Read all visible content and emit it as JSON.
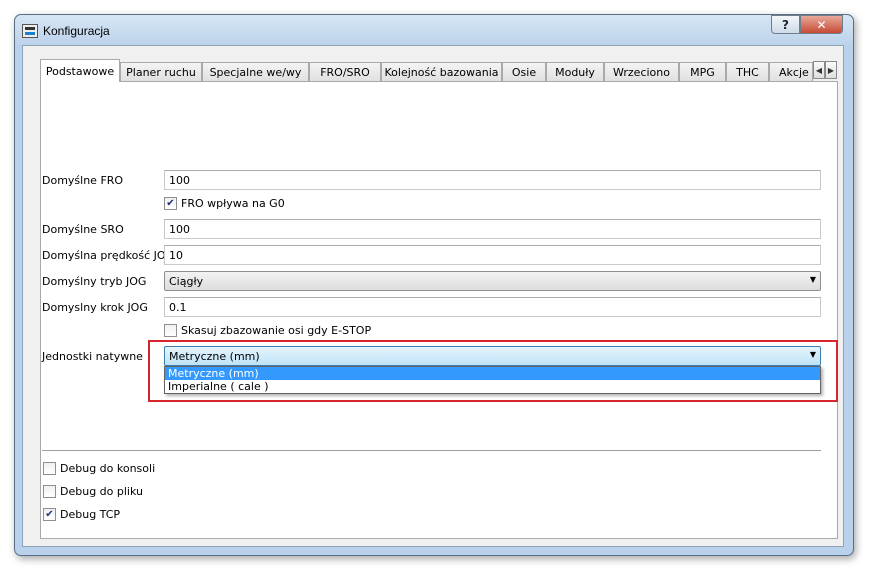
{
  "window": {
    "title": "Konfiguracja",
    "help_glyph": "?",
    "close_glyph": "✕"
  },
  "tabs": [
    {
      "label": "Podstawowe",
      "active": true
    },
    {
      "label": "Planer ruchu"
    },
    {
      "label": "Specjalne we/wy"
    },
    {
      "label": "FRO/SRO"
    },
    {
      "label": "Kolejność bazowania"
    },
    {
      "label": "Osie"
    },
    {
      "label": "Moduły"
    },
    {
      "label": "Wrzeciono"
    },
    {
      "label": "MPG"
    },
    {
      "label": "THC"
    },
    {
      "label": "Akcje"
    }
  ],
  "form": {
    "fro_label": "Domyślne FRO",
    "fro_value": "100",
    "fro_g0_label": "FRO wpływa na G0",
    "fro_g0_checked": true,
    "sro_label": "Domyślne SRO",
    "sro_value": "100",
    "jog_speed_label": "Domyślna prędkość JOG",
    "jog_speed_value": "10",
    "jog_mode_label": "Domyślny tryb JOG",
    "jog_mode_value": "Ciągły",
    "jog_step_label": "Domyslny krok JOG",
    "jog_step_value": "0.1",
    "estop_label": "Skasuj zbazowanie osi gdy E-STOP",
    "estop_checked": false,
    "units_label": "Jednostki natywne",
    "units_value": "Metryczne (mm)",
    "units_options": [
      "Metryczne (mm)",
      "Imperialne ( cale )"
    ]
  },
  "debug": {
    "console_label": "Debug do konsoli",
    "console_checked": false,
    "file_label": "Debug do pliku",
    "file_checked": false,
    "tcp_label": "Debug TCP",
    "tcp_checked": true
  },
  "colors": {
    "highlight": "#d6262d",
    "selection": "#3399ff"
  }
}
